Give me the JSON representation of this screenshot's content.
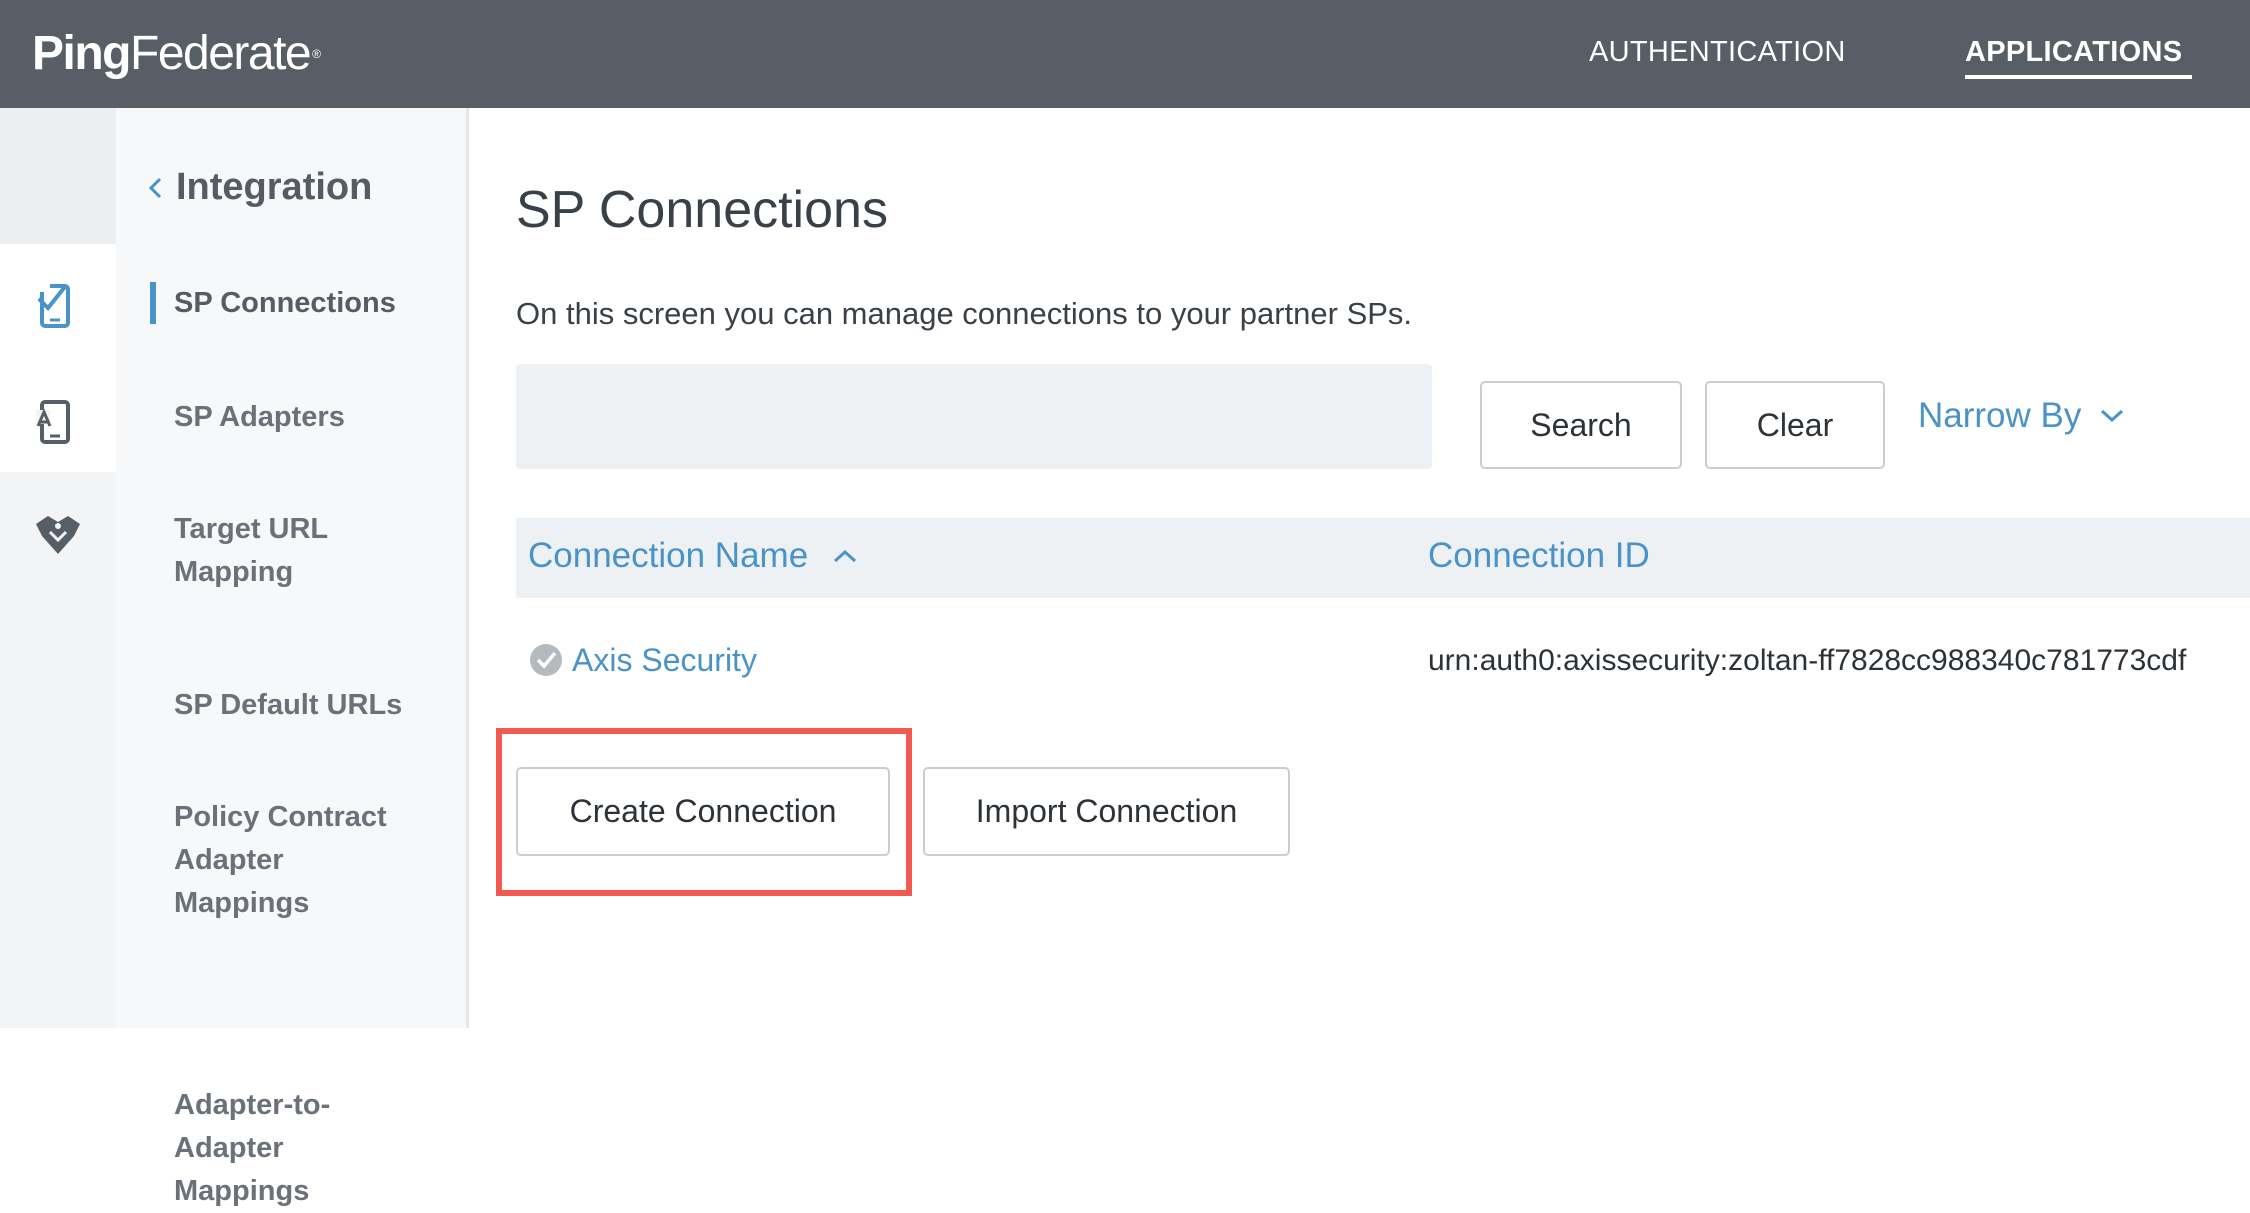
{
  "header": {
    "logo_ping": "Ping",
    "logo_federate": "Federate",
    "logo_reg": "®",
    "nav": [
      {
        "label": "AUTHENTICATION"
      },
      {
        "label": "APPLICATIONS"
      }
    ]
  },
  "rail": {
    "icons": [
      "sp-connections-icon",
      "sp-adapters-icon",
      "target-url-mapping-icon"
    ]
  },
  "subnav": {
    "back_label": "Integration",
    "items": [
      {
        "label": "SP Connections"
      },
      {
        "label": "SP Adapters"
      },
      {
        "label": "Target URL Mapping"
      },
      {
        "label": "SP Default URLs"
      },
      {
        "label": "Policy Contract Adapter Mappings"
      },
      {
        "label": "Adapter-to-Adapter Mappings"
      }
    ]
  },
  "main": {
    "title": "SP Connections",
    "description": "On this screen you can manage connections to your partner SPs.",
    "search": {
      "value": "",
      "placeholder": ""
    },
    "search_button": "Search",
    "clear_button": "Clear",
    "narrow_by": "Narrow By",
    "table": {
      "columns": [
        "Connection Name",
        "Connection ID"
      ],
      "rows": [
        {
          "name": "Axis Security",
          "id": "urn:auth0:axissecurity:zoltan-ff7828cc988340c781773cdf"
        }
      ]
    },
    "create_button": "Create Connection",
    "import_button": "Import Connection"
  },
  "colors": {
    "topbar": "#575e66",
    "accent": "#4a93c9",
    "highlight": "#f25a4e"
  }
}
